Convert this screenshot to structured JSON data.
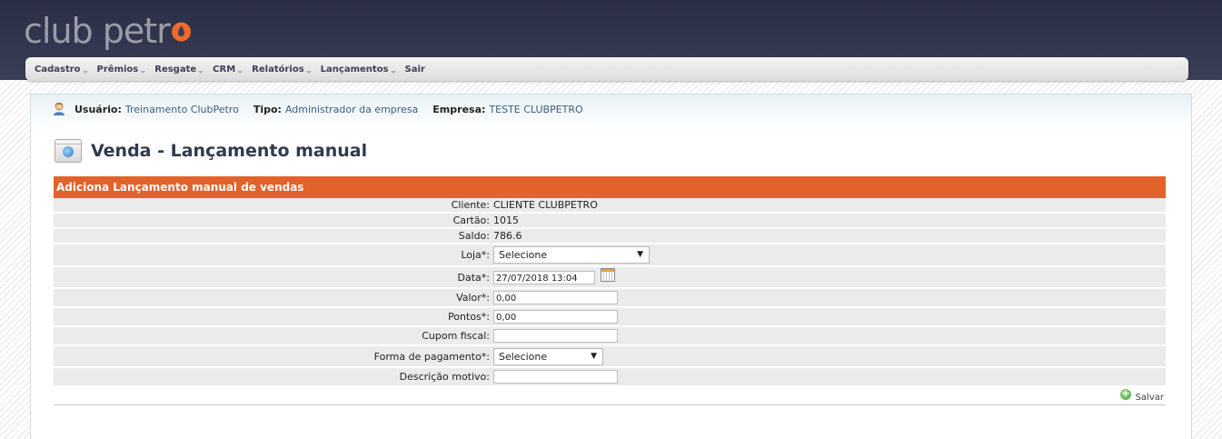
{
  "app": {
    "logo_text": "club petr",
    "brand_color": "#e2622c"
  },
  "menu": [
    "Cadastro",
    "Prêmios",
    "Resgate",
    "CRM",
    "Relatórios",
    "Lançamentos",
    "Sair"
  ],
  "userbar": {
    "user_label": "Usuário:",
    "user_value": "Treinamento ClubPetro",
    "type_label": "Tipo:",
    "type_value": "Administrador da empresa",
    "company_label": "Empresa:",
    "company_value": "TESTE CLUBPETRO"
  },
  "page": {
    "title": "Venda - Lançamento manual"
  },
  "panel": {
    "title": "Adiciona Lançamento manual de vendas"
  },
  "form": {
    "cliente": {
      "label": "Cliente:",
      "value": "CLIENTE CLUBPETRO"
    },
    "cartao": {
      "label": "Cartão:",
      "value": "1015"
    },
    "saldo": {
      "label": "Saldo:",
      "value": "786.6"
    },
    "loja": {
      "label": "Loja*:",
      "value": "Selecione"
    },
    "data": {
      "label": "Data*:",
      "value": "27/07/2018 13:04"
    },
    "valor": {
      "label": "Valor*:",
      "value": "0,00"
    },
    "pontos": {
      "label": "Pontos*:",
      "value": "0,00"
    },
    "cupom": {
      "label": "Cupom fiscal:",
      "value": ""
    },
    "pagamento": {
      "label": "Forma de pagamento*:",
      "value": "Selecione"
    },
    "motivo": {
      "label": "Descrição motivo:",
      "value": ""
    }
  },
  "actions": {
    "save_label": "Salvar"
  }
}
